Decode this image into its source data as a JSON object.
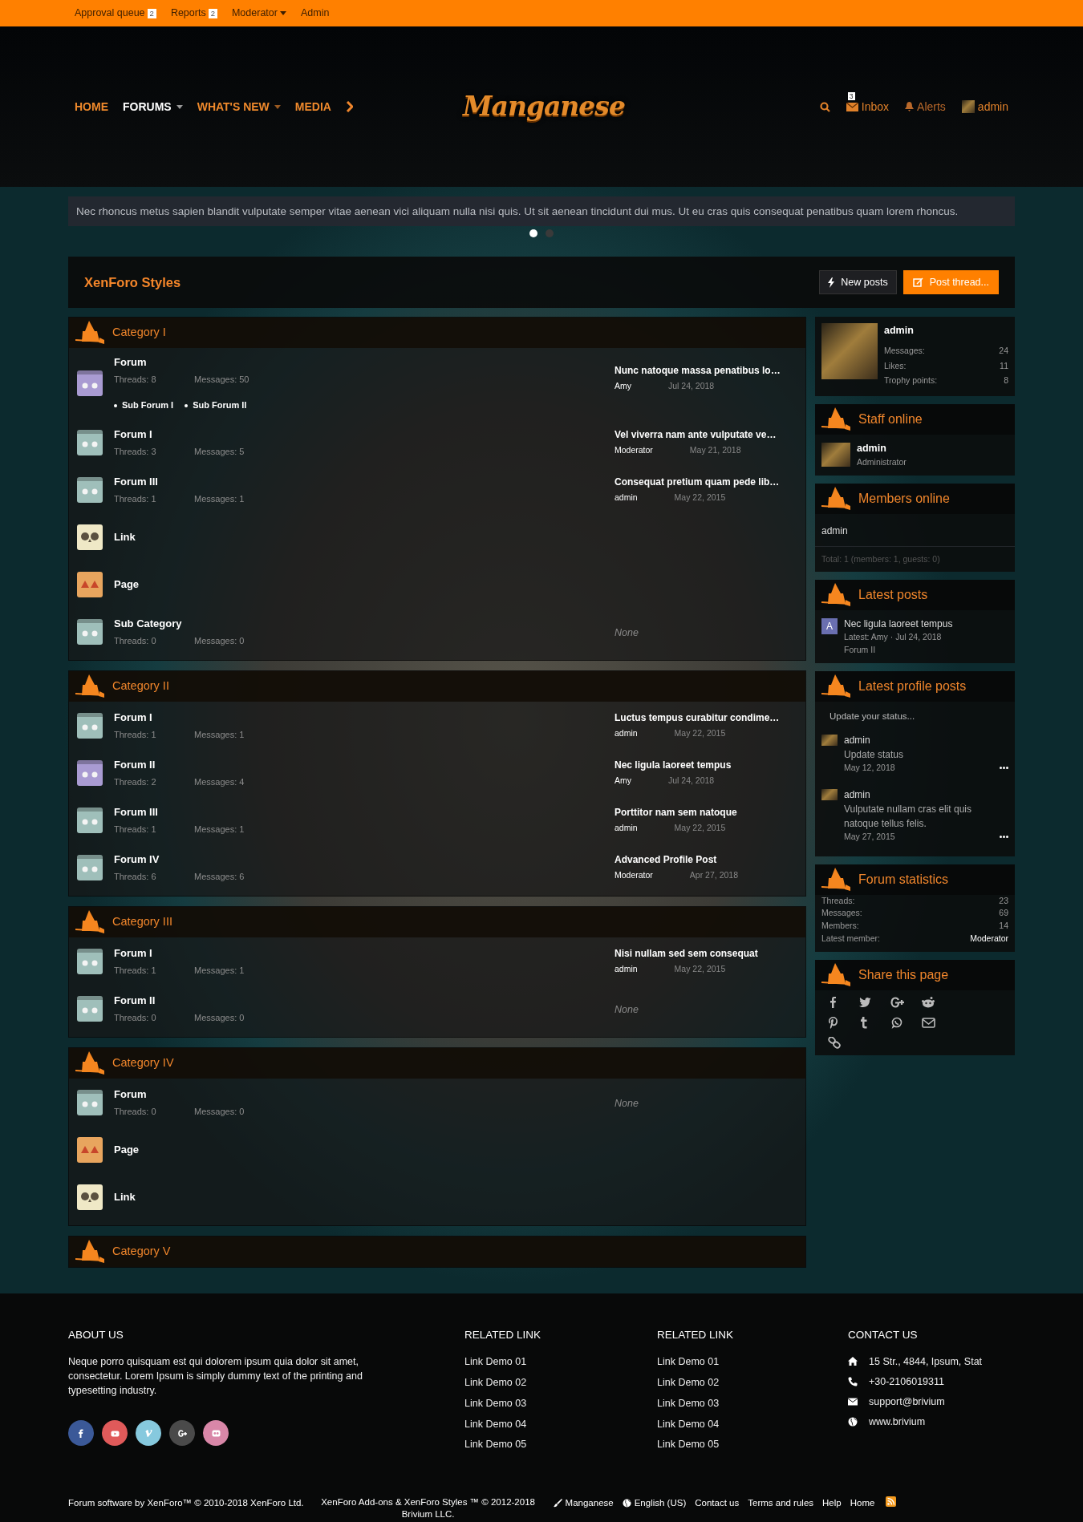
{
  "top_bar": [
    {
      "label": "Approval queue",
      "badge": "2",
      "dropdown": false
    },
    {
      "label": "Reports",
      "badge": "2",
      "dropdown": false
    },
    {
      "label": "Moderator",
      "dropdown": true
    },
    {
      "label": "Admin",
      "dropdown": false
    }
  ],
  "header": {
    "nav": [
      {
        "label": "HOME",
        "selected": false,
        "dropdown": false
      },
      {
        "label": "FORUMS",
        "selected": true,
        "dropdown": true
      },
      {
        "label": "WHAT'S NEW",
        "selected": false,
        "dropdown": true
      },
      {
        "label": "MEDIA",
        "selected": false,
        "dropdown": false
      }
    ],
    "logo": "Manganese",
    "inbox": {
      "label": "Inbox",
      "badge": "3"
    },
    "alerts": {
      "label": "Alerts"
    },
    "user": {
      "label": "admin"
    }
  },
  "notice": {
    "text": "Nec rhoncus metus sapien blandit vulputate semper vitae aenean vici aliquam nulla nisi quis. Ut sit aenean tincidunt dui mus. Ut eu cras quis consequat penatibus quam lorem rhoncus.",
    "slides": [
      {
        "selected": true
      },
      {
        "selected": false
      }
    ]
  },
  "page_title": "XenForo Styles",
  "buttons": [
    {
      "kind": "new-posts",
      "label": "New posts"
    },
    {
      "kind": "post-thread",
      "label": "Post thread..."
    }
  ],
  "categories": [
    {
      "title": "Category I",
      "nodes": [
        {
          "kind": "forum",
          "title": "Forum",
          "color": "#a99bd2",
          "threads": "Threads: 8",
          "messages": "Messages: 50",
          "subforums": [
            "Sub Forum I",
            "Sub Forum II"
          ],
          "last_post": {
            "title": "Nunc natoque massa penatibus lo…",
            "user": "Amy",
            "date": "Jul 24, 2018"
          }
        },
        {
          "kind": "forum",
          "title": "Forum I",
          "color": "#9fbfba",
          "threads": "Threads: 3",
          "messages": "Messages: 5",
          "last_post": {
            "title": "Vel viverra nam ante vulputate ve…",
            "user": "Moderator",
            "date": "May 21, 2018"
          }
        },
        {
          "kind": "forum",
          "title": "Forum III",
          "color": "#9fbfba",
          "threads": "Threads: 1",
          "messages": "Messages: 1",
          "last_post": {
            "title": "Consequat pretium quam pede lib…",
            "user": "admin",
            "date": "May 22, 2015"
          }
        },
        {
          "kind": "link",
          "title": "Link"
        },
        {
          "kind": "page",
          "title": "Page"
        },
        {
          "kind": "forum",
          "title": "Sub Category",
          "color": "#9fbfba",
          "threads": "Threads: 0",
          "messages": "Messages: 0",
          "none": "None"
        }
      ]
    },
    {
      "title": "Category II",
      "nodes": [
        {
          "kind": "forum",
          "title": "Forum I",
          "color": "#9fbfba",
          "threads": "Threads: 1",
          "messages": "Messages: 1",
          "last_post": {
            "title": "Luctus tempus curabitur condime…",
            "user": "admin",
            "date": "May 22, 2015"
          }
        },
        {
          "kind": "forum",
          "title": "Forum II",
          "color": "#a99bd2",
          "threads": "Threads: 2",
          "messages": "Messages: 4",
          "last_post": {
            "title": "Nec ligula laoreet tempus",
            "user": "Amy",
            "date": "Jul 24, 2018"
          }
        },
        {
          "kind": "forum",
          "title": "Forum III",
          "color": "#9fbfba",
          "threads": "Threads: 1",
          "messages": "Messages: 1",
          "last_post": {
            "title": "Porttitor nam sem natoque",
            "user": "admin",
            "date": "May 22, 2015"
          }
        },
        {
          "kind": "forum",
          "title": "Forum IV",
          "color": "#9fbfba",
          "threads": "Threads: 6",
          "messages": "Messages: 6",
          "last_post": {
            "title": "Advanced Profile Post",
            "user": "Moderator",
            "date": "Apr 27, 2018"
          }
        }
      ]
    },
    {
      "title": "Category III",
      "nodes": [
        {
          "kind": "forum",
          "title": "Forum I",
          "color": "#9fbfba",
          "threads": "Threads: 1",
          "messages": "Messages: 1",
          "last_post": {
            "title": "Nisi nullam sed sem consequat",
            "user": "admin",
            "date": "May 22, 2015"
          }
        },
        {
          "kind": "forum",
          "title": "Forum II",
          "color": "#9fbfba",
          "threads": "Threads: 0",
          "messages": "Messages: 0",
          "none": "None"
        }
      ]
    },
    {
      "title": "Category IV",
      "nodes": [
        {
          "kind": "forum",
          "title": "Forum",
          "color": "#9fbfba",
          "threads": "Threads: 0",
          "messages": "Messages: 0",
          "none": "None"
        },
        {
          "kind": "page",
          "title": "Page"
        },
        {
          "kind": "link",
          "title": "Link"
        }
      ]
    },
    {
      "title": "Category V"
    }
  ],
  "sidebar": {
    "member": {
      "name": "admin",
      "stats": [
        {
          "label": "Messages:",
          "value": "24"
        },
        {
          "label": "Likes:",
          "value": "11"
        },
        {
          "label": "Trophy points:",
          "value": "8"
        }
      ]
    },
    "staff_online": {
      "title": "Staff online",
      "members": [
        {
          "name": "admin",
          "role": "Administrator"
        }
      ]
    },
    "members_online": {
      "title": "Members online",
      "members": [
        "admin"
      ],
      "total": "Total: 1 (members: 1, guests: 0)"
    },
    "latest_posts": {
      "title": "Latest posts",
      "posts": [
        {
          "avatar": "A",
          "title": "Nec ligula laoreet tempus",
          "meta": "Latest: Amy · Jul 24, 2018",
          "forum": "Forum II"
        }
      ]
    },
    "profile_posts": {
      "title": "Latest profile posts",
      "placeholder": "Update your status...",
      "posts": [
        {
          "user": "admin",
          "text": "Update status",
          "date": "May 12, 2018"
        },
        {
          "user": "admin",
          "text": "Vulputate nullam cras elit quis natoque tellus felis.",
          "date": "May 27, 2015"
        }
      ]
    },
    "statistics": {
      "title": "Forum statistics",
      "rows": [
        {
          "label": "Threads:",
          "value": "23"
        },
        {
          "label": "Messages:",
          "value": "69"
        },
        {
          "label": "Members:",
          "value": "14"
        },
        {
          "label": "Latest member:",
          "value": "Moderator"
        }
      ]
    },
    "share": {
      "title": "Share this page"
    }
  },
  "footer": {
    "about": {
      "heading": "ABOUT US",
      "text": "Neque porro quisquam est qui dolorem ipsum quia dolor sit amet, consectetur. Lorem Ipsum is simply dummy text of the printing and typesetting industry.",
      "social": [
        {
          "color": "#3b5998"
        },
        {
          "color": "#e05a5a"
        },
        {
          "color": "#86c9de"
        },
        {
          "color": "#4a4a4a"
        },
        {
          "color": "#d987a8"
        }
      ]
    },
    "related": [
      {
        "heading": "RELATED LINK",
        "links": [
          "Link Demo 01",
          "Link Demo 02",
          "Link Demo 03",
          "Link Demo 04",
          "Link Demo 05"
        ]
      },
      {
        "heading": "RELATED LINK",
        "links": [
          "Link Demo 01",
          "Link Demo 02",
          "Link Demo 03",
          "Link Demo 04",
          "Link Demo 05"
        ]
      }
    ],
    "contact": {
      "heading": "CONTACT US",
      "items": [
        {
          "kind": "address",
          "text": "15 Str., 4844, Ipsum, Stat"
        },
        {
          "kind": "phone",
          "text": "+30-2106019311"
        },
        {
          "kind": "email",
          "text": "support@brivium"
        },
        {
          "kind": "web",
          "text": "www.brivium"
        }
      ]
    },
    "copyright": "Forum software by XenForo™ © 2010-2018 XenForo Ltd.",
    "brivium": "XenForo Add-ons & XenForo Styles ™ © 2012-2018 Brivium LLC.",
    "links": [
      {
        "kind": "style",
        "label": "Manganese"
      },
      {
        "kind": "language",
        "label": "English (US)"
      },
      {
        "kind": "plain",
        "label": "Contact us"
      },
      {
        "kind": "plain",
        "label": "Terms and rules"
      },
      {
        "kind": "plain",
        "label": "Help"
      },
      {
        "kind": "plain",
        "label": "Home"
      }
    ]
  }
}
